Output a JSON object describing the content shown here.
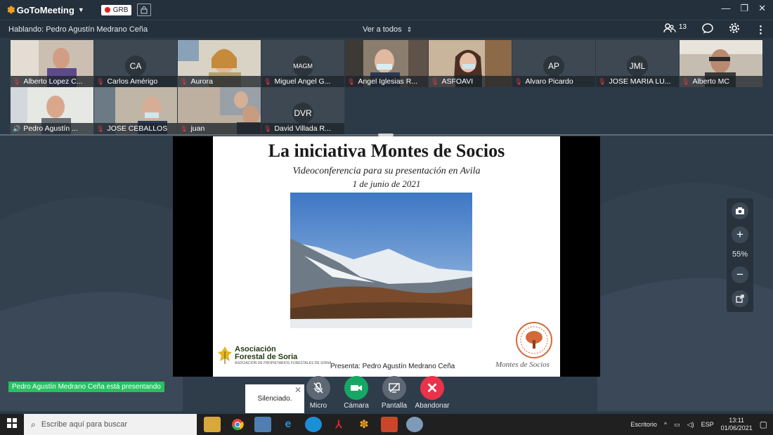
{
  "app": {
    "logo_text": "GoToMeeting",
    "recording_badge": "GRB",
    "speaking_text": "Hablando: Pedro Agustín Medrano Ceña",
    "view_all_label": "Ver a todos",
    "attendee_count": "13"
  },
  "participants": [
    {
      "name": "Alberto Lopez C...",
      "initials": "",
      "video": true
    },
    {
      "name": "Carlos Amérigo",
      "initials": "CA",
      "video": false
    },
    {
      "name": "Aurora",
      "initials": "",
      "video": true
    },
    {
      "name": "Miguel Angel G...",
      "initials": "MAGM",
      "video": false
    },
    {
      "name": "Angel Iglesias R...",
      "initials": "",
      "video": true
    },
    {
      "name": "ASFOAVI",
      "initials": "",
      "video": true
    },
    {
      "name": "Alvaro Picardo",
      "initials": "AP",
      "video": false
    },
    {
      "name": "JOSE MARIA LU...",
      "initials": "JML",
      "video": false
    },
    {
      "name": "Alberto MC",
      "initials": "",
      "video": true
    },
    {
      "name": "Pedro Agustín ...",
      "initials": "",
      "video": true
    },
    {
      "name": "JOSE CEBALLOS",
      "initials": "",
      "video": true
    },
    {
      "name": "juan",
      "initials": "",
      "video": true
    },
    {
      "name": "David Villada R...",
      "initials": "DVR",
      "video": false
    }
  ],
  "slide": {
    "title": "La iniciativa Montes de Socios",
    "subtitle": "Videoconferencia para su presentación en Avila",
    "date": "1 de junio de 2021",
    "assoc_line1": "Asociación",
    "assoc_line2": "Forestal de Soria",
    "assoc_small": "ASOCIACIÓN DE PROPIETARIOS FORESTALES DE SORIA",
    "presenter": "Presenta: Pedro Agustín Medrano Ceña",
    "montes_logo_text": "Montes de Socios"
  },
  "zoom": {
    "value": "55%"
  },
  "bottom": {
    "presenting_text": "Pedro Agustín Medrano Ceña está presentando",
    "muted_popup": "Silenciado.",
    "controls": [
      {
        "label": "Micro"
      },
      {
        "label": "Cámara"
      },
      {
        "label": "Pantalla"
      },
      {
        "label": "Abandonar"
      }
    ]
  },
  "taskbar": {
    "search_placeholder": "Escribe aquí para buscar",
    "desktop_label": "Escritorio",
    "language": "ESP",
    "time": "13:11",
    "date": "01/06/2021"
  },
  "colors": {
    "accent_green": "#26c262",
    "leave_red": "#e8334a",
    "bg_dark": "#2c3a48"
  }
}
